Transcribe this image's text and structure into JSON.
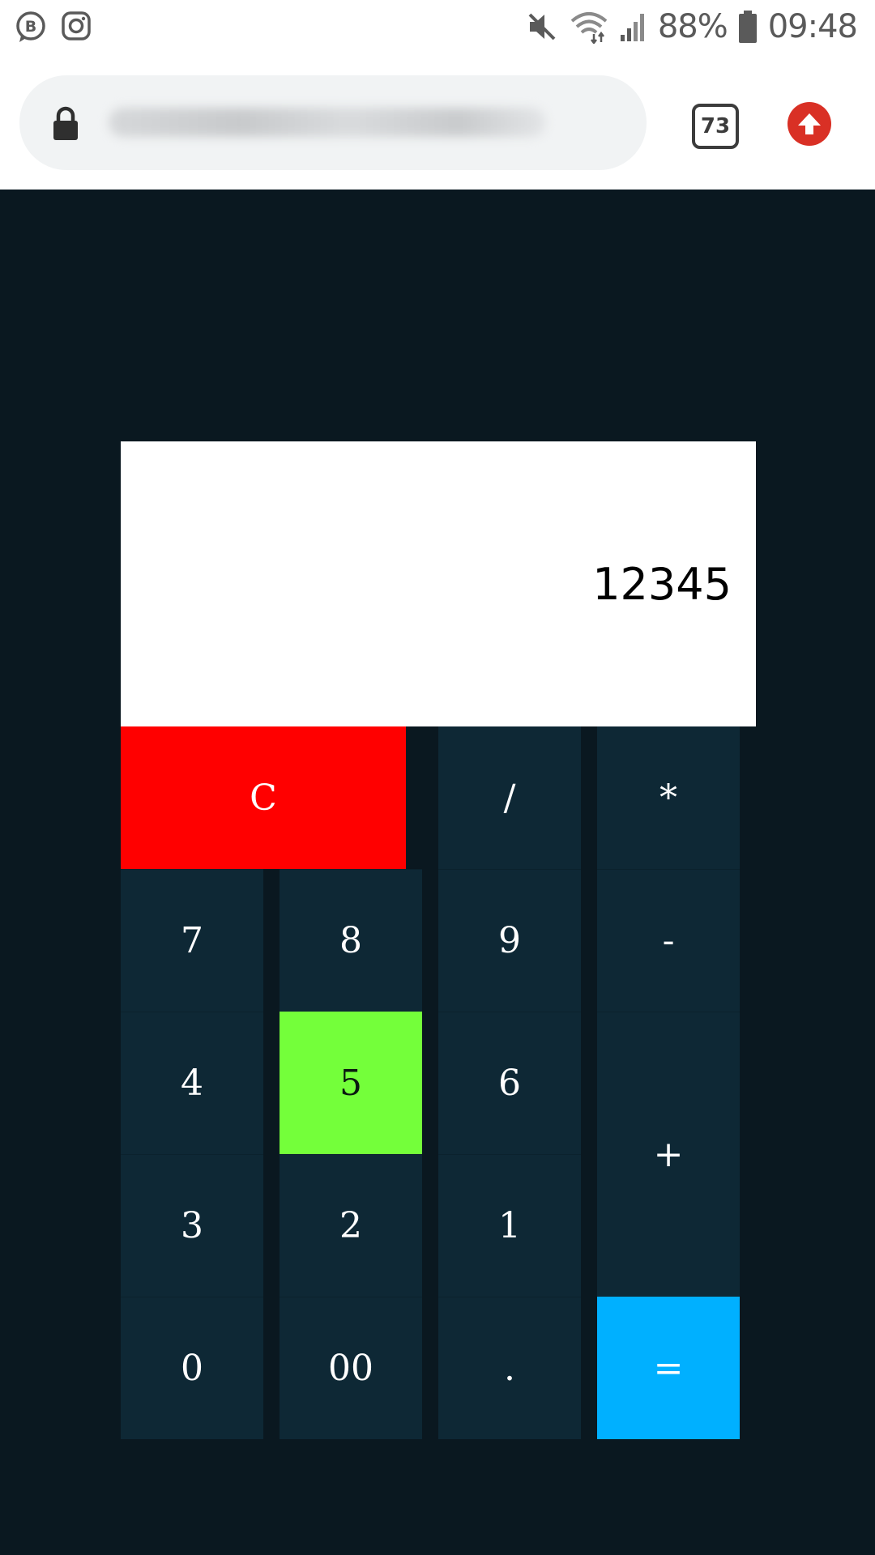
{
  "status_bar": {
    "battery": "88%",
    "time": "09:48",
    "icons": [
      "business-b-icon",
      "instagram-icon",
      "mute-icon",
      "wifi-icon",
      "signal-icon",
      "battery-icon"
    ]
  },
  "browser": {
    "url": "",
    "tab_count": "73",
    "update_icon": "arrow-up-icon"
  },
  "calculator": {
    "display": "12345",
    "keys": {
      "clear": "C",
      "divide": "/",
      "multiply": "*",
      "seven": "7",
      "eight": "8",
      "nine": "9",
      "minus": "-",
      "four": "4",
      "five": "5",
      "six": "6",
      "plus": "+",
      "three": "3",
      "two": "2",
      "one": "1",
      "zero": "0",
      "double_zero": "00",
      "dot": ".",
      "equals": "="
    }
  },
  "colors": {
    "background": "#0a1820",
    "key": "#0e2835",
    "clear_key": "#ff0000",
    "highlight_key": "#74ff3a",
    "equals_key": "#00b0ff",
    "display": "#ffffff"
  }
}
